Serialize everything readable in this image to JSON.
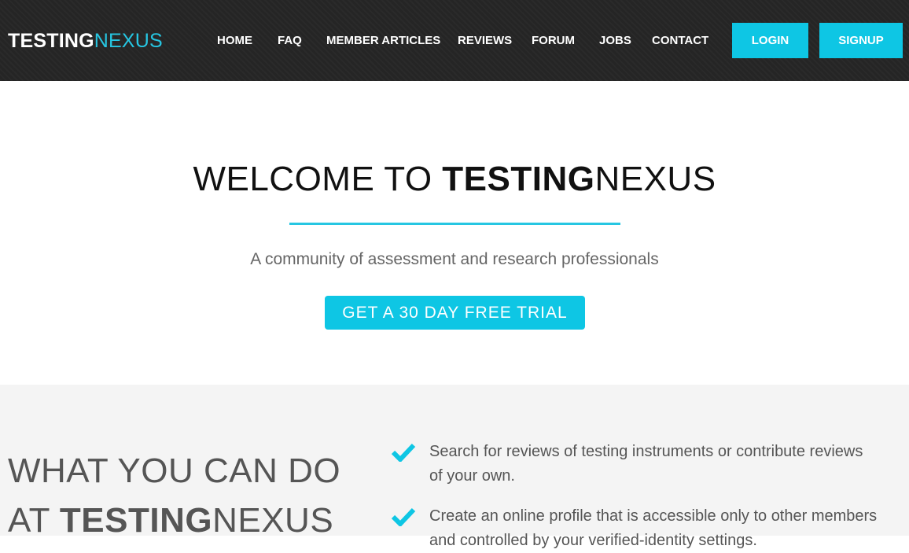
{
  "header": {
    "logo": {
      "bold": "TESTING",
      "light": "NEXUS"
    },
    "nav": [
      "HOME",
      "FAQ",
      "MEMBER ARTICLES",
      "REVIEWS",
      "FORUM",
      "JOBS",
      "CONTACT"
    ],
    "login_label": "LOGIN",
    "signup_label": "SIGNUP"
  },
  "hero": {
    "title_light": "WELCOME TO ",
    "title_bold": "TESTING",
    "title_end": "NEXUS",
    "subtitle": "A community of assessment and research professionals",
    "cta_label": "GET A 30 DAY FREE TRIAL"
  },
  "features": {
    "title_line1": "WHAT YOU CAN DO",
    "title_at": "AT ",
    "title_bold": "TESTING",
    "title_end": "NEXUS",
    "items": [
      "Search for reviews of testing instruments or contribute reviews of your own.",
      "Create an online profile that is accessible only to other members and controlled by your verified-identity settings."
    ]
  },
  "colors": {
    "accent": "#0ec6e4",
    "header_bg": "#252525",
    "section_bg": "#f4f4f4"
  },
  "icons": {
    "feature_bullet": "check-icon"
  }
}
